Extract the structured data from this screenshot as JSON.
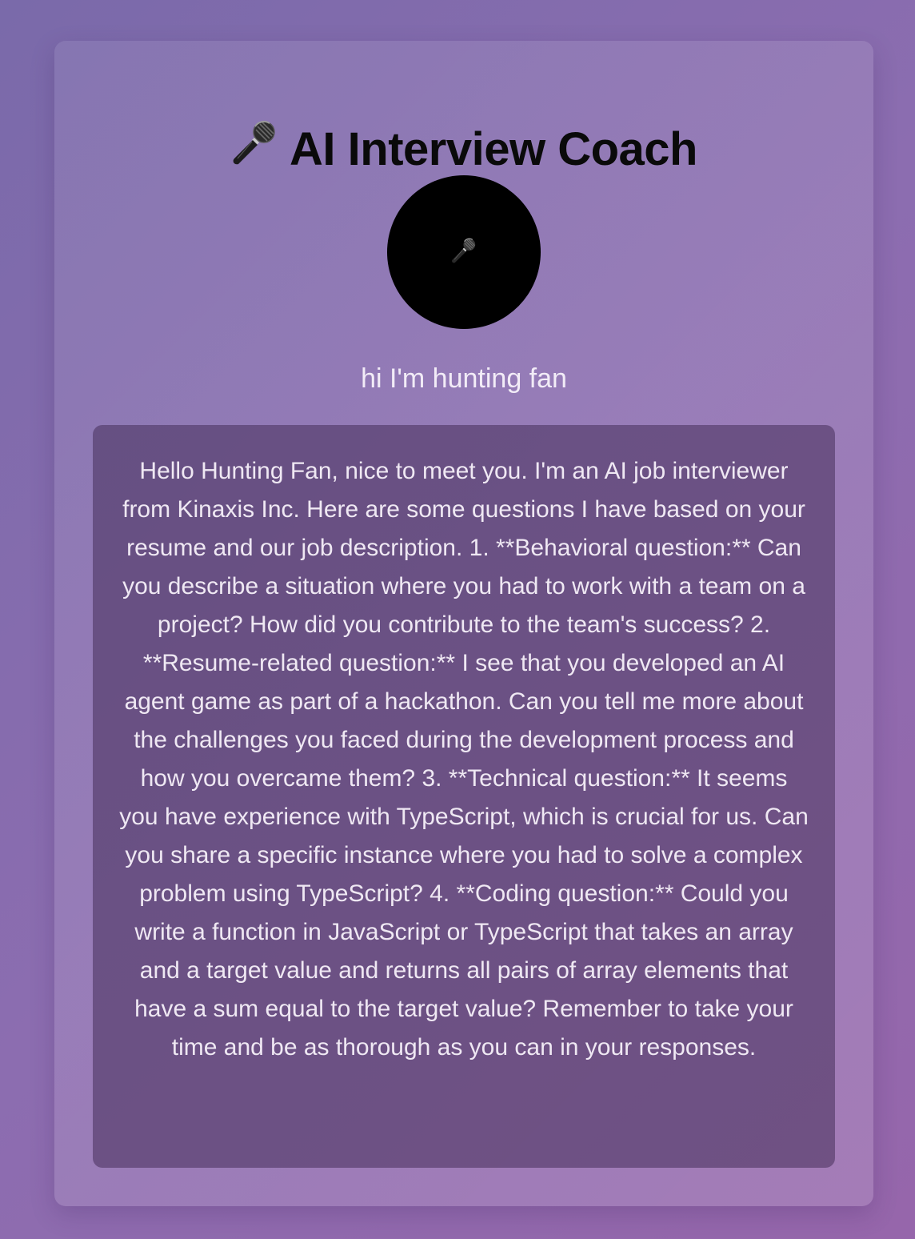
{
  "app": {
    "title": "AI Interview Coach",
    "title_icon": "microphone-icon"
  },
  "avatar": {
    "icon": "microphone-icon",
    "background": "#000000"
  },
  "transcript": {
    "user_text": "hi I'm hunting fan"
  },
  "response": {
    "text": "Hello Hunting Fan, nice to meet you. I'm an AI job interviewer from Kinaxis Inc. Here are some questions I have based on your resume and our job description. 1. **Behavioral question:** Can you describe a situation where you had to work with a team on a project? How did you contribute to the team's success? 2. **Resume-related question:** I see that you developed an AI agent game as part of a hackathon. Can you tell me more about the challenges you faced during the development process and how you overcame them? 3. **Technical question:** It seems you have experience with TypeScript, which is crucial for us. Can you share a specific instance where you had to solve a complex problem using TypeScript? 4. **Coding question:** Could you write a function in JavaScript or TypeScript that takes an array and a target value and returns all pairs of array elements that have a sum equal to the target value? Remember to take your time and be as thorough as you can in your responses."
  },
  "colors": {
    "background_start": "#7a6aaa",
    "background_end": "#9666ab",
    "title": "#0a0a0a",
    "text_light": "#f2ecf7",
    "response_box": "#5f4a78"
  }
}
